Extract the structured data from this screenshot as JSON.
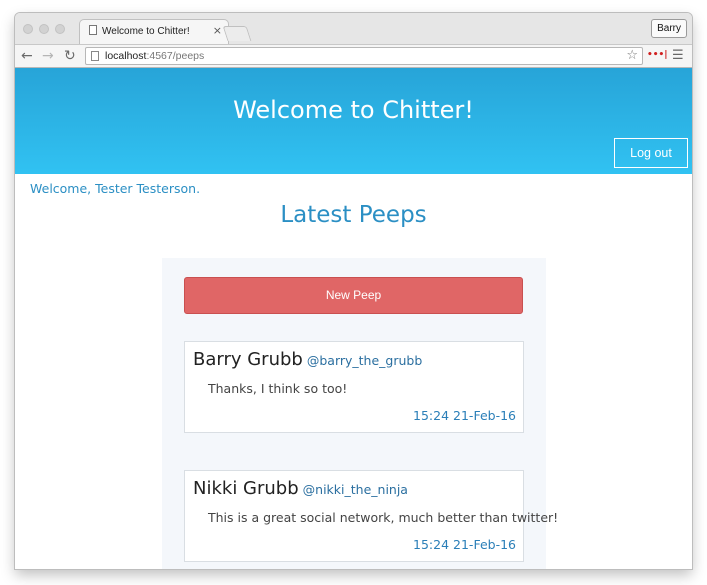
{
  "browser": {
    "tab_title": "Welcome to Chitter!",
    "tab_close": "×",
    "profile_name": "Barry",
    "url_host": "localhost",
    "url_path": ":4567/peeps",
    "back_icon": "←",
    "forward_icon": "→",
    "reload_icon": "↻",
    "star_icon": "☆",
    "extension_icon": "•••|",
    "menu_icon": "☰"
  },
  "header": {
    "title": "Welcome to Chitter!",
    "logout_label": "Log out",
    "background_color": "#2fb6ea"
  },
  "main": {
    "welcome_text": "Welcome, Tester Testerson.",
    "heading": "Latest Peeps",
    "new_peep_label": "New Peep",
    "new_peep_color": "#e06666",
    "accent_color": "#2b8fc4"
  },
  "peeps": [
    {
      "name": "Barry Grubb",
      "handle": "@barry_the_grubb",
      "text": "Thanks, I think so too!",
      "time": "15:24 21-Feb-16"
    },
    {
      "name": "Nikki Grubb",
      "handle": "@nikki_the_ninja",
      "text": "This is a great social network, much better than twitter!",
      "time": "15:24 21-Feb-16"
    }
  ]
}
